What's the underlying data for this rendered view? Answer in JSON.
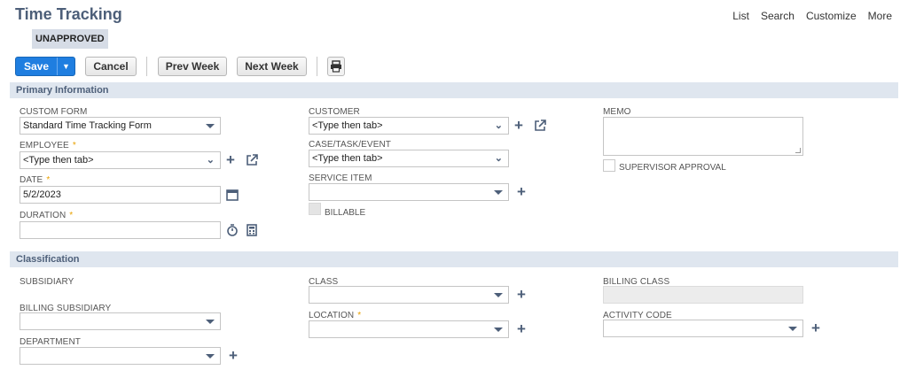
{
  "header": {
    "title": "Time Tracking",
    "links": [
      "List",
      "Search",
      "Customize",
      "More"
    ],
    "status": "UNAPPROVED"
  },
  "toolbar": {
    "save_label": "Save",
    "cancel_label": "Cancel",
    "prev_week_label": "Prev Week",
    "next_week_label": "Next Week"
  },
  "primary": {
    "title": "Primary Information",
    "custom_form": {
      "label": "CUSTOM FORM",
      "value": "Standard Time Tracking Form"
    },
    "employee": {
      "label": "EMPLOYEE",
      "value": "<Type then tab>"
    },
    "date": {
      "label": "DATE",
      "value": "5/2/2023"
    },
    "duration": {
      "label": "DURATION",
      "value": ""
    },
    "customer": {
      "label": "CUSTOMER",
      "value": "<Type then tab>"
    },
    "case_task_event": {
      "label": "CASE/TASK/EVENT",
      "value": "<Type then tab>"
    },
    "service_item": {
      "label": "SERVICE ITEM",
      "value": ""
    },
    "billable": {
      "label": "BILLABLE",
      "checked": false,
      "disabled": true
    },
    "memo": {
      "label": "MEMO",
      "value": ""
    },
    "supervisor_approval": {
      "label": "SUPERVISOR APPROVAL",
      "checked": false
    }
  },
  "classification": {
    "title": "Classification",
    "subsidiary": {
      "label": "SUBSIDIARY"
    },
    "billing_subsidiary": {
      "label": "BILLING SUBSIDIARY",
      "value": ""
    },
    "department": {
      "label": "DEPARTMENT",
      "value": ""
    },
    "class": {
      "label": "CLASS",
      "value": ""
    },
    "location": {
      "label": "LOCATION",
      "value": ""
    },
    "billing_class": {
      "label": "BILLING CLASS",
      "value": ""
    },
    "activity_code": {
      "label": "ACTIVITY CODE",
      "value": ""
    }
  },
  "required_marker": "*",
  "icons": {
    "dropdown": "chevron-down-icon",
    "multi_select": "double-chevron-down-icon",
    "add": "plus-icon",
    "open": "external-link-icon",
    "calendar": "calendar-icon",
    "timer": "stopwatch-icon",
    "calculator": "calculator-icon",
    "print": "printer-icon"
  },
  "colors": {
    "primary_button": "#1f7ee0",
    "section_bar": "#dfe6ef",
    "title": "#4d5f79",
    "required": "#e9a100"
  }
}
